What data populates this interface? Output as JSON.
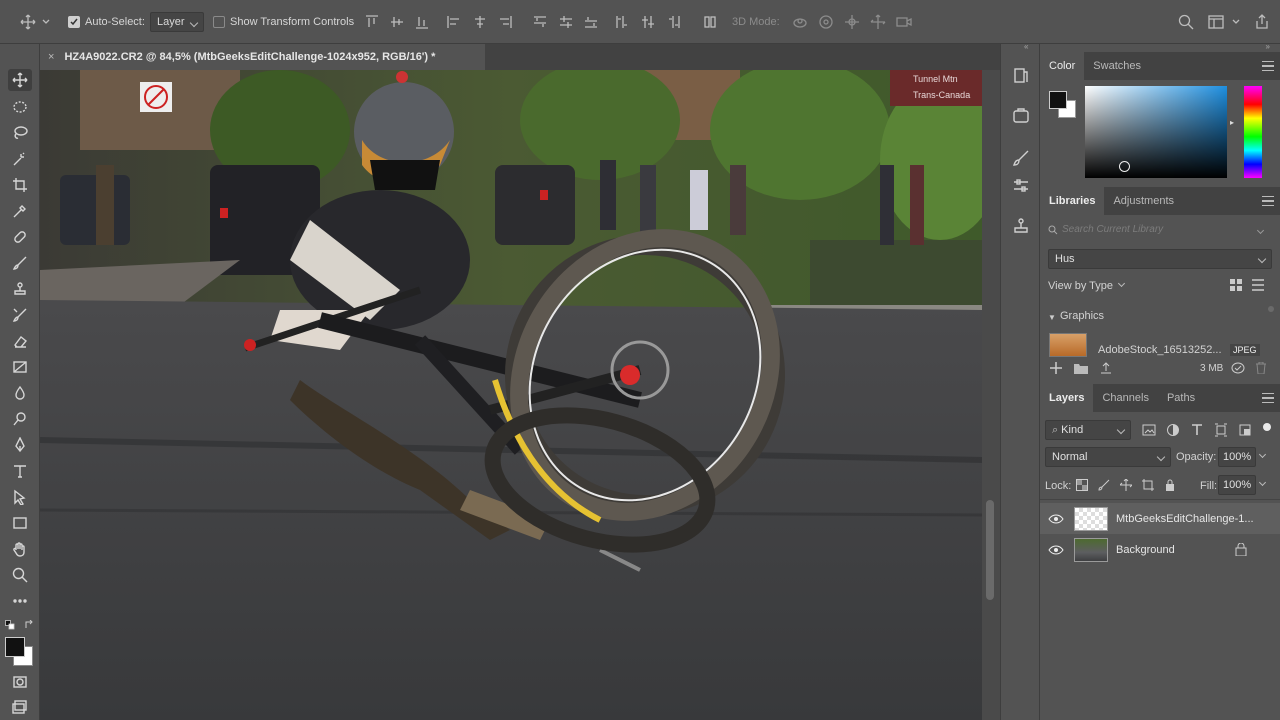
{
  "options_bar": {
    "auto_select_label": "Auto-Select:",
    "auto_select_value": "Layer",
    "show_transform_label": "Show Transform Controls",
    "mode_3d_label": "3D Mode:"
  },
  "document": {
    "tab_title": "HZ4A9022.CR2 @ 84,5% (MtbGeeksEditChallenge-1024x952, RGB/16') *",
    "close_glyph": "×",
    "street_sign_text": "Tunnel Mtn",
    "street_sign_text2": "Trans-Canada"
  },
  "color_panel": {
    "tabs": [
      "Color",
      "Swatches"
    ],
    "foreground": "#111111",
    "background": "#ffffff"
  },
  "libraries_panel": {
    "tabs": [
      "Libraries",
      "Adjustments"
    ],
    "search_placeholder": "Search Current Library",
    "library_name": "Hus",
    "view_by": "View by Type",
    "section": "Graphics",
    "asset_name": "AdobeStock_16513252...",
    "asset_badge": "JPEG",
    "storage": "3 MB"
  },
  "layers_panel": {
    "tabs": [
      "Layers",
      "Channels",
      "Paths"
    ],
    "filter_kind": "Kind",
    "blend_mode": "Normal",
    "opacity_label": "Opacity:",
    "opacity_value": "100%",
    "lock_label": "Lock:",
    "fill_label": "Fill:",
    "fill_value": "100%",
    "layers": [
      {
        "name": "MtbGeeksEditChallenge-1...",
        "selected": true
      },
      {
        "name": "Background",
        "selected": false
      }
    ]
  },
  "colors": {
    "ui_bg": "#535353",
    "panel_dark": "#424242",
    "accent_color_field": "#2a8ad0"
  }
}
